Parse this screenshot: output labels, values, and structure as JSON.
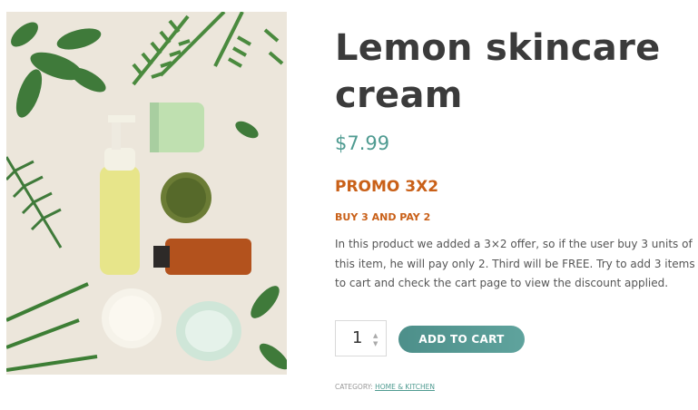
{
  "product": {
    "title_line1": "Lemon skincare",
    "title_line2": "cream",
    "price": "$7.99",
    "promo_title": "PROMO 3X2",
    "promo_subtitle": "BUY 3 AND PAY 2",
    "description": "In this product we added a 3×2 offer, so if the user buy 3 units of this item, he will pay only 2. Third will be FREE. Try to add 3 items to cart and check the cart page to view the discount applied.",
    "quantity": "1",
    "add_to_cart_label": "ADD TO CART",
    "category_label": "CATEGORY:",
    "category_link": "HOME & KITCHEN"
  },
  "colors": {
    "accent": "#4f9b91",
    "promo": "#c96018",
    "title": "#3b3b3b"
  },
  "icons": {
    "qty_up": "chevron-up-icon",
    "qty_down": "chevron-down-icon"
  }
}
